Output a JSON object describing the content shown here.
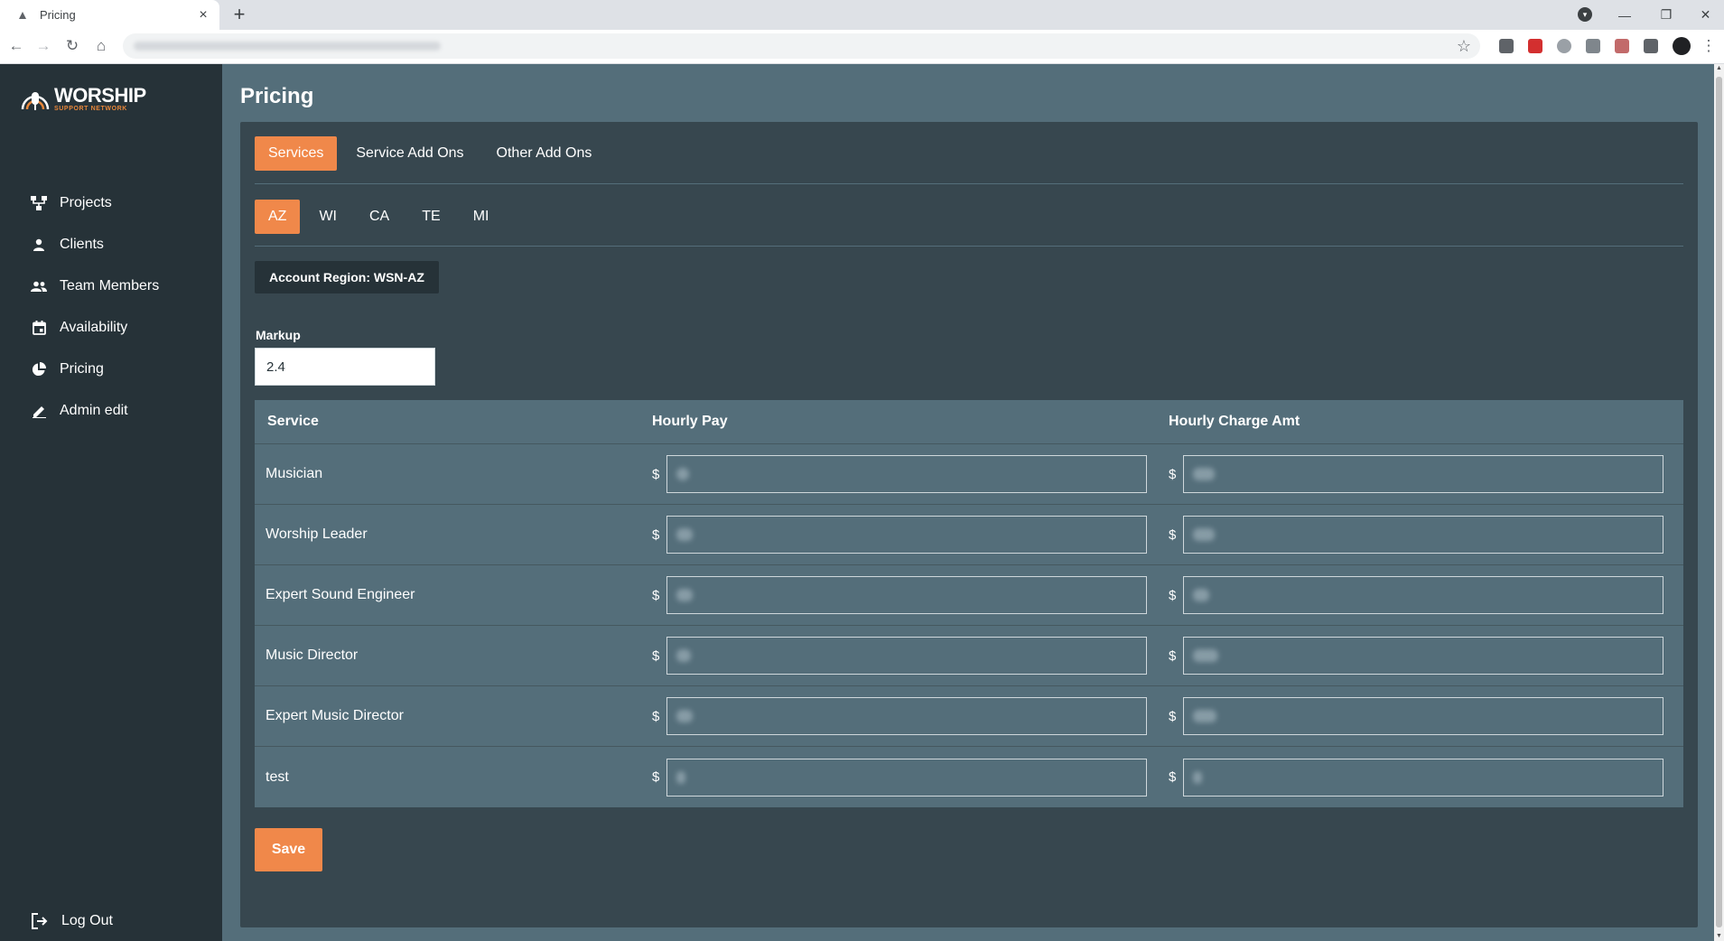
{
  "browser": {
    "tab_title": "Pricing",
    "tab_close": "×",
    "new_tab": "+",
    "url": ""
  },
  "logo": {
    "title": "WORSHIP",
    "subtitle": "SUPPORT NETWORK"
  },
  "sidebar": {
    "items": [
      {
        "label": "Projects",
        "icon": "projects-icon"
      },
      {
        "label": "Clients",
        "icon": "person-icon"
      },
      {
        "label": "Team Members",
        "icon": "group-icon"
      },
      {
        "label": "Availability",
        "icon": "calendar-icon"
      },
      {
        "label": "Pricing",
        "icon": "pie-chart-icon"
      },
      {
        "label": "Admin edit",
        "icon": "pencil-icon"
      }
    ],
    "logout_label": "Log Out"
  },
  "page": {
    "title": "Pricing",
    "tabs": [
      "Services",
      "Service Add Ons",
      "Other Add Ons"
    ],
    "active_tab": "Services",
    "regions": [
      "AZ",
      "WI",
      "CA",
      "TE",
      "MI"
    ],
    "active_region": "AZ",
    "account_region": "Account Region: WSN-AZ",
    "markup_label": "Markup",
    "markup_value": "2.4"
  },
  "table": {
    "headers": [
      "Service",
      "Hourly Pay",
      "Hourly Charge Amt"
    ],
    "currency_symbol": "$",
    "rows": [
      {
        "service": "Musician"
      },
      {
        "service": "Worship Leader"
      },
      {
        "service": "Expert Sound Engineer"
      },
      {
        "service": "Music Director"
      },
      {
        "service": "Expert Music Director"
      },
      {
        "service": "test"
      }
    ]
  },
  "save_label": "Save",
  "colors": {
    "accent": "#f0884a",
    "sidebar_bg": "#263238",
    "main_bg": "#546e7a",
    "card_bg": "#37474f"
  }
}
